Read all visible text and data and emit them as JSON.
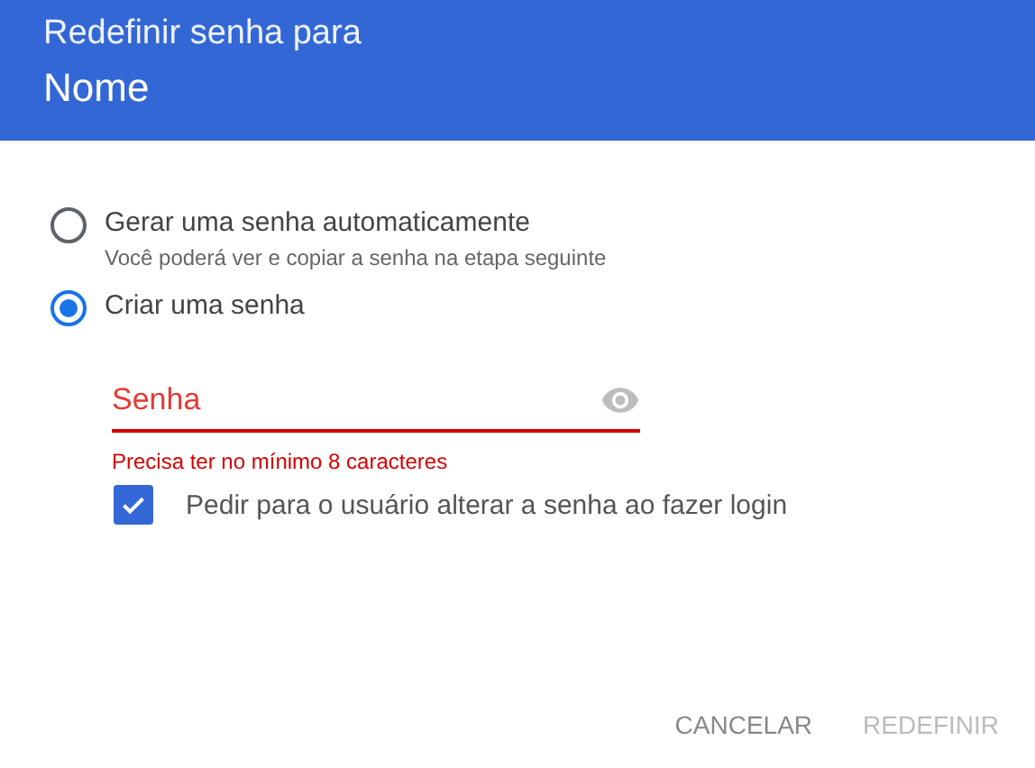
{
  "header": {
    "title": "Redefinir senha para",
    "name": "Nome"
  },
  "options": [
    {
      "label": "Gerar uma senha automaticamente",
      "hint": "Você poderá ver e copiar a senha na etapa seguinte",
      "selected": false
    },
    {
      "label": "Criar uma senha",
      "selected": true
    }
  ],
  "password_field": {
    "placeholder": "Senha",
    "error": true,
    "error_text": "Precisa ter no mínimo 8 caracteres"
  },
  "require_change": {
    "label": "Pedir para o usuário alterar a senha ao fazer login",
    "checked": true
  },
  "buttons": [
    {
      "label": "CANCELAR",
      "disabled": false
    },
    {
      "label": "REDEFINIR",
      "disabled": true
    }
  ]
}
